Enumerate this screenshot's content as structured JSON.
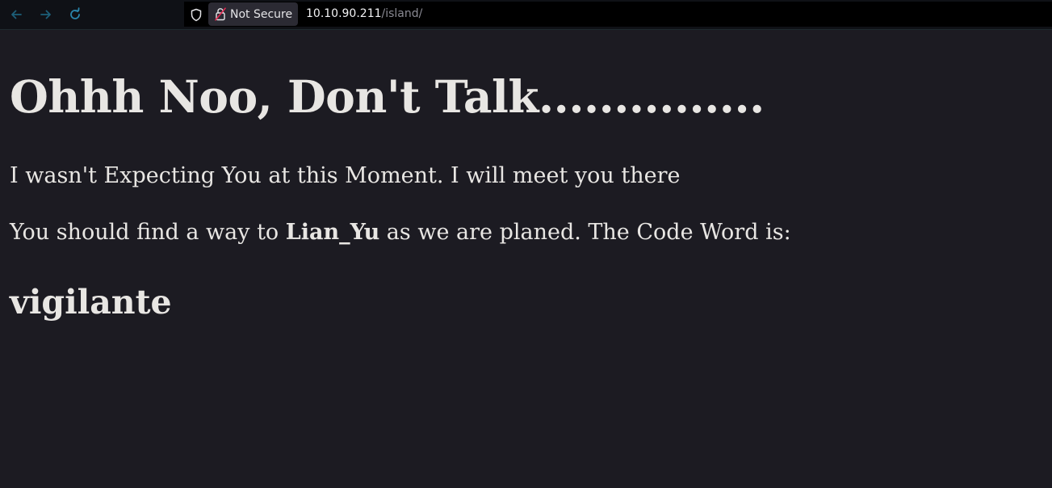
{
  "browser": {
    "nav": {
      "back_icon": "arrow-left-icon",
      "forward_icon": "arrow-right-icon",
      "reload_icon": "reload-icon"
    },
    "urlbar": {
      "shield_icon": "shield-icon",
      "security_icon": "insecure-lock-icon",
      "security_label": "Not Secure",
      "url_host": "10.10.90.211",
      "url_path": "/island/"
    },
    "colors": {
      "nav_icon": "#1f6f8b",
      "insecure_lock": "#e22850",
      "page_background": "#1c1b22",
      "text": "#e8e6e3"
    }
  },
  "page": {
    "heading": "Ohhh Noo, Don't Talk...............",
    "line1": "I wasn't Expecting You at this Moment. I will meet you there",
    "line2_before": "You should find a way to ",
    "line2_bold": "Lian_Yu",
    "line2_after": " as we are planed. The Code Word is:",
    "code_word": "vigilante"
  }
}
